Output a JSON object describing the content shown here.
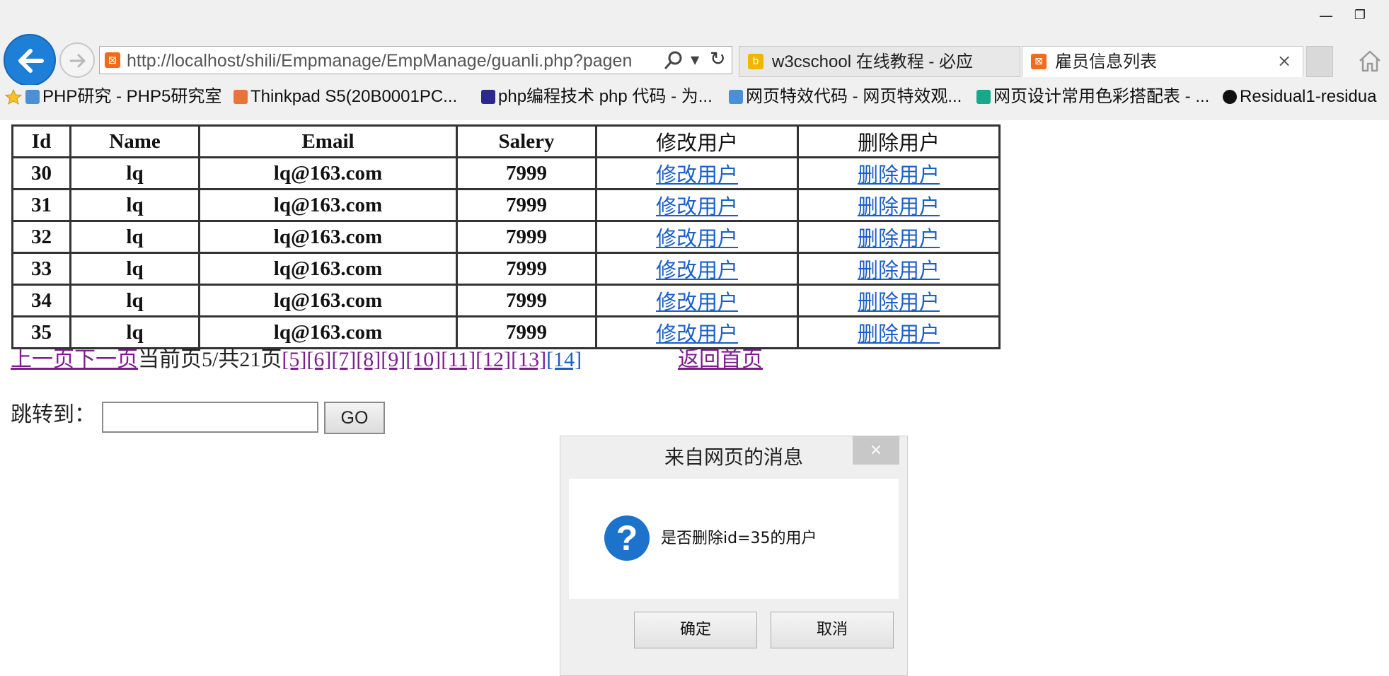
{
  "browser": {
    "window_controls": {
      "minimize": "—",
      "restore": "❐"
    },
    "address": {
      "url": "http://localhost/shili/Empmanage/EmpManage/guanli.php?pagen"
    },
    "tabs": [
      {
        "label": "w3cschool 在线教程 - 必应",
        "icon": "bing-icon",
        "color": "#f2b600",
        "active": false
      },
      {
        "label": "雇员信息列表",
        "icon": "xampp-icon",
        "color": "#f26a1b",
        "active": true
      }
    ],
    "tab_close": "×",
    "favorites": [
      {
        "label": "PHP研究 - PHP5研究室",
        "icon": "ie-page-icon",
        "color": "#4a90d9"
      },
      {
        "label": "Thinkpad S5(20B0001PC...",
        "icon": "shop-icon",
        "color": "#e8743a"
      },
      {
        "label": "php编程技术 php 代码 - 为...",
        "icon": "film-icon",
        "color": "#2a2a8c"
      },
      {
        "label": "网页特效代码 - 网页特效观...",
        "icon": "ie-page-icon",
        "color": "#4a90d9"
      },
      {
        "label": "网页设计常用色彩搭配表 - ...",
        "icon": "site-icon",
        "color": "#18a889"
      },
      {
        "label": "Residual1-residua",
        "icon": "github-icon",
        "color": "#111111"
      }
    ]
  },
  "table": {
    "headers": [
      "Id",
      "Name",
      "Email",
      "Salery",
      "修改用户",
      "删除用户"
    ],
    "rows": [
      {
        "id": "30",
        "name": "lq",
        "email": "lq@163.com",
        "salary": "7999",
        "edit": "修改用户",
        "delete": "删除用户"
      },
      {
        "id": "31",
        "name": "lq",
        "email": "lq@163.com",
        "salary": "7999",
        "edit": "修改用户",
        "delete": "删除用户"
      },
      {
        "id": "32",
        "name": "lq",
        "email": "lq@163.com",
        "salary": "7999",
        "edit": "修改用户",
        "delete": "删除用户"
      },
      {
        "id": "33",
        "name": "lq",
        "email": "lq@163.com",
        "salary": "7999",
        "edit": "修改用户",
        "delete": "删除用户"
      },
      {
        "id": "34",
        "name": "lq",
        "email": "lq@163.com",
        "salary": "7999",
        "edit": "修改用户",
        "delete": "删除用户"
      },
      {
        "id": "35",
        "name": "lq",
        "email": "lq@163.com",
        "salary": "7999",
        "edit": "修改用户",
        "delete": "删除用户"
      }
    ]
  },
  "pager": {
    "prev": "上一页",
    "next": "下一页",
    "status": "当前页5/共21页",
    "pages": [
      "[5]",
      "[6]",
      "[7]",
      "[8]",
      "[9]",
      "[10]",
      "[11]",
      "[12]",
      "[13]",
      "[14]"
    ],
    "home": "返回首页"
  },
  "jump": {
    "label": "跳转到：",
    "value": "",
    "button": "GO"
  },
  "dialog": {
    "title": "来自网页的消息",
    "close": "×",
    "message": "是否删除id=35的用户",
    "icon": "?",
    "ok": "确定",
    "cancel": "取消"
  },
  "colors": {
    "visited_link": "#7d1e8f",
    "link": "#1a5ec9",
    "back_button": "#1e7fd8",
    "question_icon": "#1d72cc"
  }
}
